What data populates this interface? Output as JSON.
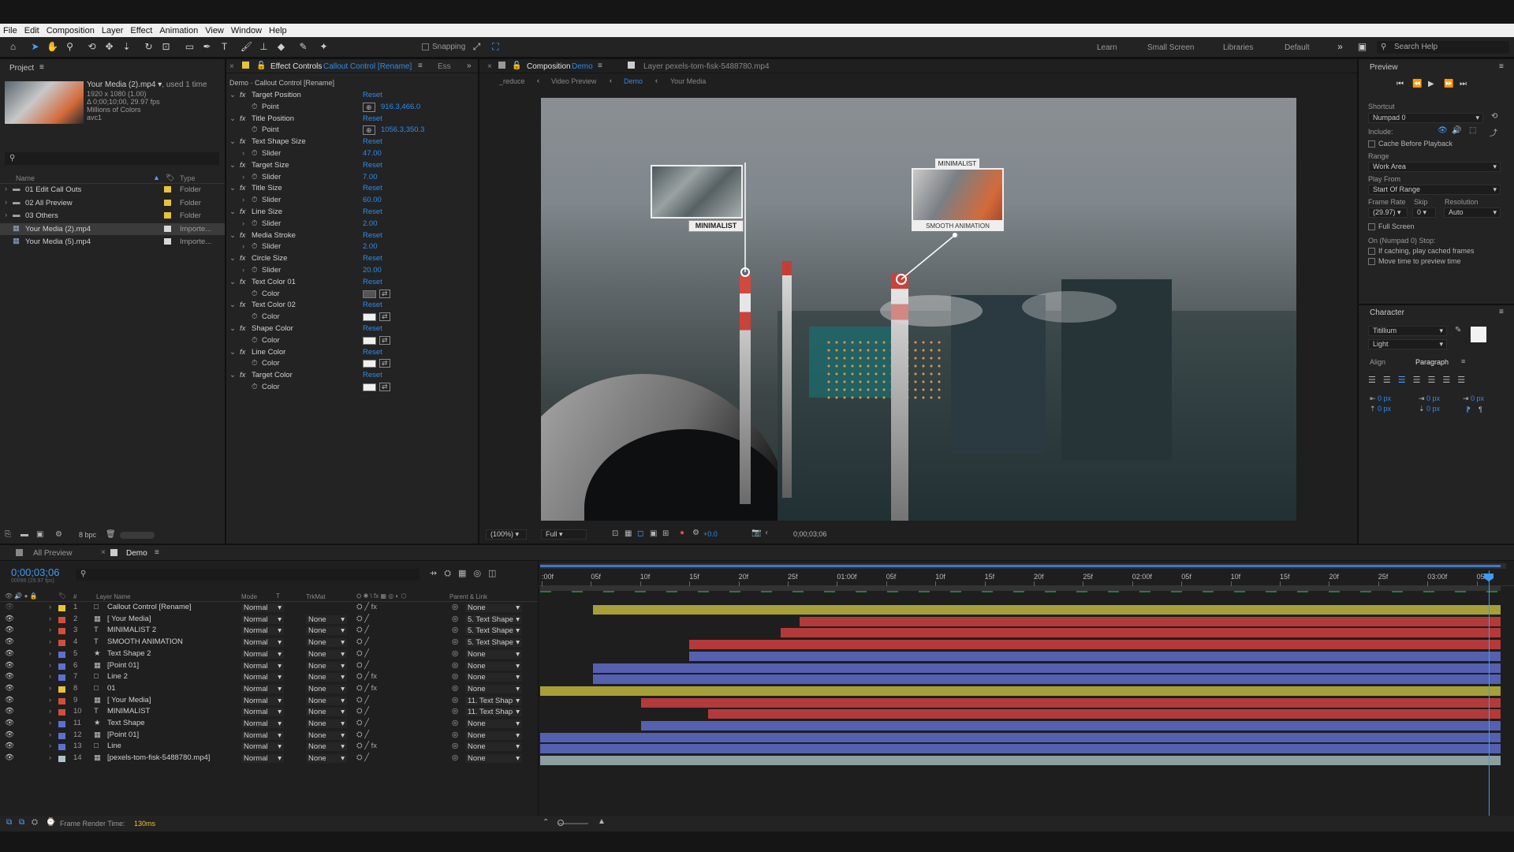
{
  "menu": [
    "File",
    "Edit",
    "Composition",
    "Layer",
    "Effect",
    "Animation",
    "View",
    "Window",
    "Help"
  ],
  "toolbar": {
    "snapping": "Snapping",
    "workspaces": [
      "Learn",
      "Small Screen",
      "Libraries",
      "Default"
    ],
    "search": "Search Help"
  },
  "project": {
    "title": "Project",
    "item_name": "Your Media (2).mp4",
    "used": ", used 1 time",
    "info": [
      "1920 x 1080 (1.00)",
      "Δ 0;00;10;00, 29.97 fps",
      "Millions of Colors",
      "avc1"
    ],
    "col_name": "Name",
    "col_type": "Type",
    "items": [
      {
        "name": "01 Edit Call Outs",
        "type": "Folder",
        "color": "#e8c23a"
      },
      {
        "name": "02 All Preview",
        "type": "Folder",
        "color": "#e8c23a"
      },
      {
        "name": "03 Others",
        "type": "Folder",
        "color": "#e8c23a"
      },
      {
        "name": "Your Media (2).mp4",
        "type": "Importe...",
        "color": "#d8d8d8"
      },
      {
        "name": "Your Media (5).mp4",
        "type": "Importe...",
        "color": "#d8d8d8"
      }
    ],
    "bpc": "8 bpc"
  },
  "effects": {
    "tab": "Effect Controls",
    "tab_layer": "Callout Control [Rename]",
    "tab2": "Ess",
    "header": "Demo · Callout Control [Rename]",
    "reset": "Reset",
    "rows": [
      {
        "name": "Target Position",
        "sub": "Point",
        "val": "916.3,466.0"
      },
      {
        "name": "Title Position",
        "sub": "Point",
        "val": "1056.3,350.3"
      },
      {
        "name": "Text Shape Size",
        "sub": "Slider",
        "val": "47.00"
      },
      {
        "name": "Target Size",
        "sub": "Slider",
        "val": "7.00"
      },
      {
        "name": "Title Size",
        "sub": "Slider",
        "val": "60.00"
      },
      {
        "name": "Line Size",
        "sub": "Slider",
        "val": "2.00"
      },
      {
        "name": "Media Stroke",
        "sub": "Slider",
        "val": "2.00"
      },
      {
        "name": "Circle Size",
        "sub": "Slider",
        "val": "20.00"
      },
      {
        "name": "Text Color 01",
        "sub": "Color",
        "val": ""
      },
      {
        "name": "Text Color 02",
        "sub": "Color",
        "val": ""
      },
      {
        "name": "Shape Color",
        "sub": "Color",
        "val": ""
      },
      {
        "name": "Line Color",
        "sub": "Color",
        "val": ""
      },
      {
        "name": "Target Color",
        "sub": "Color",
        "val": ""
      }
    ]
  },
  "comp": {
    "tab": "Composition",
    "tab_name": "Demo",
    "layer_tab": "Layer  pexels-tom-fisk-5488780.mp4",
    "crumbs": [
      "_reduce",
      "Video Preview",
      "Demo",
      "Your Media"
    ],
    "callout1": "MINIMALIST",
    "callout2_title": "MINIMALIST",
    "callout2_sub": "SMOOTH ANIMATION",
    "zoom": "(100%)",
    "quality": "Full",
    "exposure": "+0.0",
    "timecode": "0;00;03;06"
  },
  "preview": {
    "title": "Preview",
    "shortcut_label": "Shortcut",
    "shortcut": "Numpad 0",
    "include": "Include:",
    "cache": "Cache Before Playback",
    "range_label": "Range",
    "range": "Work Area",
    "play_from_label": "Play From",
    "play_from": "Start Of Range",
    "frame_rate_label": "Frame Rate",
    "skip_label": "Skip",
    "resolution_label": "Resolution",
    "frame_rate": "(29.97)",
    "skip": "0",
    "resolution": "Auto",
    "full_screen": "Full Screen",
    "stop_label": "On (Numpad 0) Stop:",
    "opt1": "If caching, play cached frames",
    "opt2": "Move time to preview time"
  },
  "character": {
    "title": "Character",
    "font": "Titillium",
    "style": "Light",
    "align": "Align",
    "paragraph": "Paragraph",
    "px": "0 px"
  },
  "timeline": {
    "tab1": "All Preview",
    "tab2": "Demo",
    "timecode": "0;00;03;06",
    "fps": "00096 (29.97 fps)",
    "col_name": "Layer Name",
    "col_mode": "Mode",
    "col_trk": "TrkMat",
    "col_parent": "Parent & Link",
    "render_label": "Frame Render Time:",
    "render_val": "130ms",
    "ruler": [
      ":00f",
      "05f",
      "10f",
      "15f",
      "20f",
      "25f",
      "01:00f",
      "05f",
      "10f",
      "15f",
      "20f",
      "25f",
      "02:00f",
      "05f",
      "10f",
      "15f",
      "20f",
      "25f",
      "03:00f",
      "05f"
    ],
    "layers": [
      {
        "n": "1",
        "name": "Callout Control [Rename]",
        "color": "#e8c23a",
        "mode": "Normal",
        "trk": "",
        "parent": "None",
        "bar": "#a6a03a",
        "start": 0.055,
        "end": 1
      },
      {
        "n": "2",
        "name": "[ Your Media]",
        "color": "#d44d3c",
        "mode": "Normal",
        "trk": "None",
        "parent": "5. Text Shape",
        "bar": "#b33a3a",
        "start": 0.27,
        "end": 1
      },
      {
        "n": "3",
        "name": "MINIMALIST 2",
        "color": "#d44d3c",
        "mode": "Normal",
        "trk": "None",
        "parent": "5. Text Shape",
        "bar": "#b33a3a",
        "start": 0.25,
        "end": 1
      },
      {
        "n": "4",
        "name": "SMOOTH ANIMATION",
        "color": "#d44d3c",
        "mode": "Normal",
        "trk": "None",
        "parent": "5. Text Shape",
        "bar": "#b33a3a",
        "start": 0.155,
        "end": 1
      },
      {
        "n": "5",
        "name": "Text Shape 2",
        "color": "#5f6fd1",
        "mode": "Normal",
        "trk": "None",
        "parent": "None",
        "bar": "#5560b0",
        "start": 0.155,
        "end": 1
      },
      {
        "n": "6",
        "name": "[Point 01]",
        "color": "#5f6fd1",
        "mode": "Normal",
        "trk": "None",
        "parent": "None",
        "bar": "#5560b0",
        "start": 0.055,
        "end": 1
      },
      {
        "n": "7",
        "name": "Line 2",
        "color": "#5f6fd1",
        "mode": "Normal",
        "trk": "None",
        "parent": "None",
        "bar": "#5560b0",
        "start": 0.055,
        "end": 1
      },
      {
        "n": "8",
        "name": "01",
        "color": "#e8c23a",
        "mode": "Normal",
        "trk": "None",
        "parent": "None",
        "bar": "#a6a03a",
        "start": 0,
        "end": 1
      },
      {
        "n": "9",
        "name": "[ Your Media]",
        "color": "#d44d3c",
        "mode": "Normal",
        "trk": "None",
        "parent": "11. Text Shap",
        "bar": "#b33a3a",
        "start": 0.105,
        "end": 1
      },
      {
        "n": "10",
        "name": "MINIMALIST",
        "color": "#d44d3c",
        "mode": "Normal",
        "trk": "None",
        "parent": "11. Text Shap",
        "bar": "#b33a3a",
        "start": 0.175,
        "end": 1
      },
      {
        "n": "11",
        "name": "Text Shape",
        "color": "#5f6fd1",
        "mode": "Normal",
        "trk": "None",
        "parent": "None",
        "bar": "#5560b0",
        "start": 0.105,
        "end": 1
      },
      {
        "n": "12",
        "name": "[Point 01]",
        "color": "#5f6fd1",
        "mode": "Normal",
        "trk": "None",
        "parent": "None",
        "bar": "#5560b0",
        "start": 0,
        "end": 1
      },
      {
        "n": "13",
        "name": "Line",
        "color": "#5f6fd1",
        "mode": "Normal",
        "trk": "None",
        "parent": "None",
        "bar": "#5560b0",
        "start": 0,
        "end": 1
      },
      {
        "n": "14",
        "name": "[pexels-tom-fisk-5488780.mp4]",
        "color": "#a8c4c8",
        "mode": "Normal",
        "trk": "None",
        "parent": "None",
        "bar": "#8b9ea0",
        "start": 0,
        "end": 1
      }
    ]
  }
}
